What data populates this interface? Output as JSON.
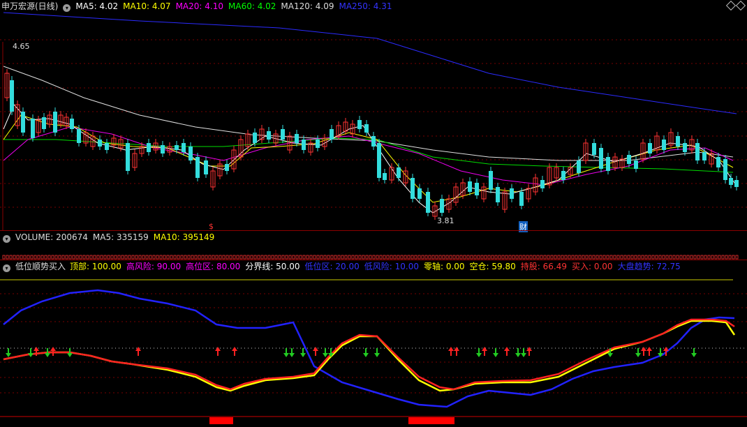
{
  "header": {
    "title": "申万宏源(日线)",
    "items": [
      {
        "label": "MA5:",
        "value": "4.02",
        "color": "#ffffff"
      },
      {
        "label": "MA10:",
        "value": "4.07",
        "color": "#ffff00"
      },
      {
        "label": "MA20:",
        "value": "4.10",
        "color": "#ff00ff"
      },
      {
        "label": "MA60:",
        "value": "4.02",
        "color": "#00ff00"
      },
      {
        "label": "MA120:",
        "value": "4.09",
        "color": "#dddddd"
      },
      {
        "label": "MA250:",
        "value": "4.31",
        "color": "#3333ff"
      }
    ]
  },
  "price_chart": {
    "high_label": "4.65",
    "low_label": "3.81",
    "marker_s": "$",
    "marker_cai": "财"
  },
  "volume_bar": {
    "items": [
      {
        "label": "VOLUME:",
        "value": "200674",
        "color": "#dddddd"
      },
      {
        "label": "MA5:",
        "value": "335159",
        "color": "#dddddd"
      },
      {
        "label": "MA10:",
        "value": "395149",
        "color": "#ffff00"
      }
    ]
  },
  "indicator_bar": {
    "title": "低位顺势买入",
    "items": [
      {
        "label": "顶部:",
        "value": "100.00",
        "color": "#ffff00"
      },
      {
        "label": "高风险:",
        "value": "90.00",
        "color": "#ff00ff"
      },
      {
        "label": "高位区:",
        "value": "80.00",
        "color": "#ff00ff"
      },
      {
        "label": "分界线:",
        "value": "50.00",
        "color": "#ffffff"
      },
      {
        "label": "低位区:",
        "value": "20.00",
        "color": "#3333ff"
      },
      {
        "label": "低风险:",
        "value": "10.00",
        "color": "#3333ff"
      },
      {
        "label": "零轴:",
        "value": "0.00",
        "color": "#ffff00"
      },
      {
        "label": "空仓:",
        "value": "59.80",
        "color": "#ffff00"
      },
      {
        "label": "持股:",
        "value": "66.49",
        "color": "#ff3333"
      },
      {
        "label": "买入:",
        "value": "0.00",
        "color": "#ff3333"
      },
      {
        "label": "大盘趋势:",
        "value": "72.75",
        "color": "#3333ff"
      }
    ]
  }
}
